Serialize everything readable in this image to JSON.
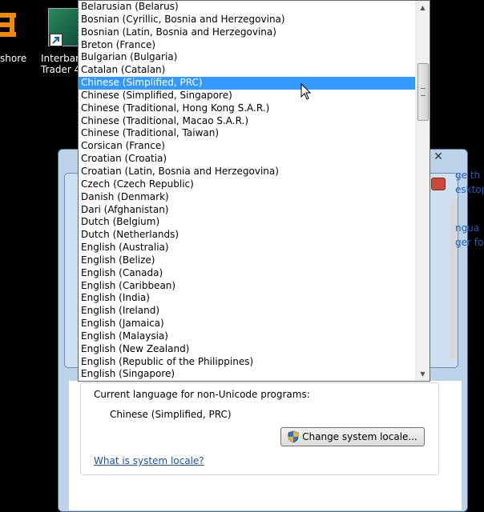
{
  "desktop": {
    "left_label": "shore",
    "app_label_line1": "Interban",
    "app_label_line2": "Trader 4"
  },
  "background_dialog": {
    "side_links": [
      "ge th",
      "esktop",
      "ngua",
      "ger fo"
    ]
  },
  "region_panel": {
    "current_language_label": "Current language for non-Unicode programs:",
    "current_language_value": "Chinese (Simplified, PRC)",
    "change_locale_button": "Change system locale...",
    "what_is_link": "What is system locale?"
  },
  "dropdown": {
    "selected_index": 6,
    "items": [
      "Belarusian (Belarus)",
      "Bosnian (Cyrillic, Bosnia and Herzegovina)",
      "Bosnian (Latin, Bosnia and Herzegovina)",
      "Breton (France)",
      "Bulgarian (Bulgaria)",
      "Catalan (Catalan)",
      "Chinese (Simplified, PRC)",
      "Chinese (Simplified, Singapore)",
      "Chinese (Traditional, Hong Kong S.A.R.)",
      "Chinese (Traditional, Macao S.A.R.)",
      "Chinese (Traditional, Taiwan)",
      "Corsican (France)",
      "Croatian (Croatia)",
      "Croatian (Latin, Bosnia and Herzegovina)",
      "Czech (Czech Republic)",
      "Danish (Denmark)",
      "Dari (Afghanistan)",
      "Dutch (Belgium)",
      "Dutch (Netherlands)",
      "English (Australia)",
      "English (Belize)",
      "English (Canada)",
      "English (Caribbean)",
      "English (India)",
      "English (Ireland)",
      "English (Jamaica)",
      "English (Malaysia)",
      "English (New Zealand)",
      "English (Republic of the Philippines)",
      "English (Singapore)"
    ]
  },
  "colors": {
    "selection": "#3399ff",
    "link": "#1a4fb8",
    "logo": "#f28a00"
  }
}
